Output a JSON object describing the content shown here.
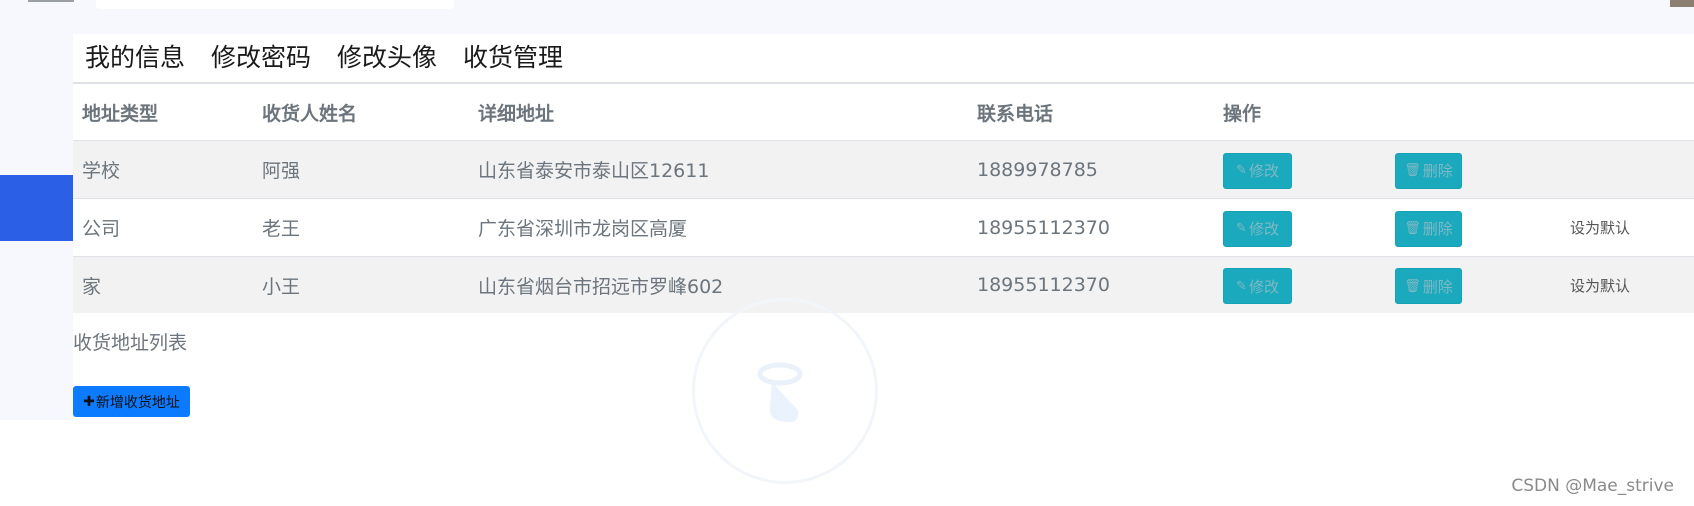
{
  "tabs": [
    "我的信息",
    "修改密码",
    "修改头像",
    "收货管理"
  ],
  "table": {
    "headers": [
      "地址类型",
      "收货人姓名",
      "详细地址",
      "联系电话",
      "操作"
    ],
    "rows": [
      {
        "type": "学校",
        "name": "阿强",
        "address": "山东省泰安市泰山区12611",
        "phone": "1889978785",
        "edit": "修改",
        "delete": "删除",
        "set_default": ""
      },
      {
        "type": "公司",
        "name": "老王",
        "address": "广东省深圳市龙岗区高厦",
        "phone": "18955112370",
        "edit": "修改",
        "delete": "删除",
        "set_default": "设为默认"
      },
      {
        "type": "家",
        "name": "小王",
        "address": "山东省烟台市招远市罗峰602",
        "phone": "18955112370",
        "edit": "修改",
        "delete": "删除",
        "set_default": "设为默认"
      }
    ]
  },
  "caption": "收货地址列表",
  "add_button": "新增收货地址",
  "icons": {
    "edit": "edit-icon",
    "delete": "trash-icon",
    "add": "plus-icon"
  },
  "colors": {
    "accent": "#1aa9bd",
    "primary": "#0d7bff",
    "sidebar_accent": "#2b5fe6"
  },
  "watermark": "CSDN @Mae_strive"
}
